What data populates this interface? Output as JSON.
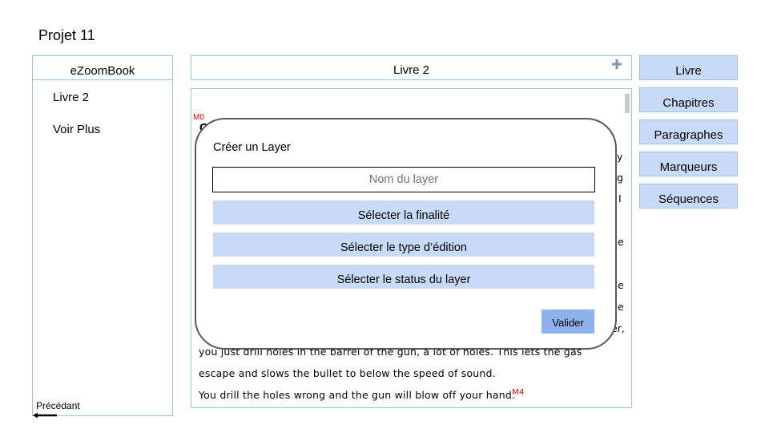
{
  "project": {
    "title": "Projet 11"
  },
  "sidebar": {
    "header": "eZoomBook",
    "items": [
      {
        "label": "Livre 2"
      },
      {
        "label": "Voir Plus"
      }
    ],
    "prev_label": "Précédant"
  },
  "book": {
    "title": "Livre 2",
    "markers": {
      "start": "M0",
      "end": "M4"
    },
    "heading_fragment": "Cl",
    "right_fragments": [
      "y",
      "g",
      "I",
      "e",
      "e",
      "e",
      "er,"
    ],
    "visible_lines": [
      "you just drill holes in the barrel of the gun, a lot of holes. This lets the gas",
      "escape and slows the bullet to below the speed of sound.",
      "You drill the holes wrong and the gun will blow off your hand."
    ]
  },
  "menu": {
    "items": [
      {
        "label": "Livre"
      },
      {
        "label": "Chapitres"
      },
      {
        "label": "Paragraphes"
      },
      {
        "label": "Marqueurs"
      },
      {
        "label": "Séquences"
      }
    ]
  },
  "dialog": {
    "title": "Créer un Layer",
    "name_placeholder": "Nom du layer",
    "select_finalite": "Sélecter la finalité",
    "select_type": "Sélecter le type d’édition",
    "select_status": "Sélecter le status du layer",
    "validate_label": "Valider"
  },
  "colors": {
    "accent_fill": "#c9daf8",
    "accent_border": "#9ec3de",
    "button_fill": "#8eb2ee",
    "marker": "#e00000",
    "plus_icon": "#7f95b5"
  },
  "icons": {
    "add": "plus-icon",
    "back": "arrow-left-icon"
  }
}
